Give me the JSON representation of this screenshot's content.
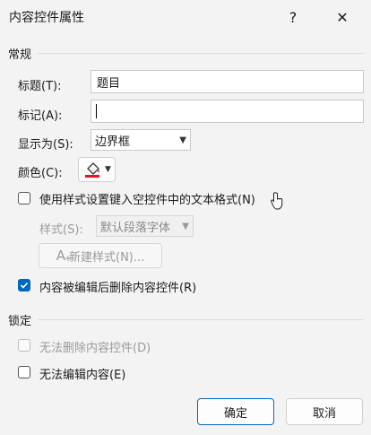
{
  "window": {
    "title": "内容控件属性"
  },
  "titlebar": {
    "help_glyph": "?",
    "close_glyph": "✕"
  },
  "general": {
    "section_label": "常规",
    "title_label": "标题(T):",
    "title_value": "题目",
    "tag_label": "标记(A):",
    "tag_value": "",
    "show_as_label": "显示为(S):",
    "show_as_value": "边界框",
    "color_label": "颜色(C):",
    "color_swatch": "#e81123",
    "style_checkbox_label": "使用样式设置键入空控件中的文本格式(N)",
    "style_checkbox_checked": false,
    "style_label": "样式(S):",
    "style_value": "默认段落字体",
    "new_style_button": "新建样式(N)...",
    "remove_checkbox_label": "内容被编辑后删除内容控件(R)",
    "remove_checkbox_checked": true
  },
  "locking": {
    "section_label": "锁定",
    "no_delete_label": "无法删除内容控件(D)",
    "no_delete_checked": false,
    "no_edit_label": "无法编辑内容(E)",
    "no_edit_checked": false
  },
  "buttons": {
    "ok": "确定",
    "cancel": "取消"
  },
  "colors": {
    "accent": "#0067c0"
  },
  "icons": [
    "help-icon",
    "close-icon",
    "paint-bucket-icon",
    "chevron-down-icon",
    "checkmark-icon",
    "new-style-icon",
    "cursor-icon"
  ]
}
